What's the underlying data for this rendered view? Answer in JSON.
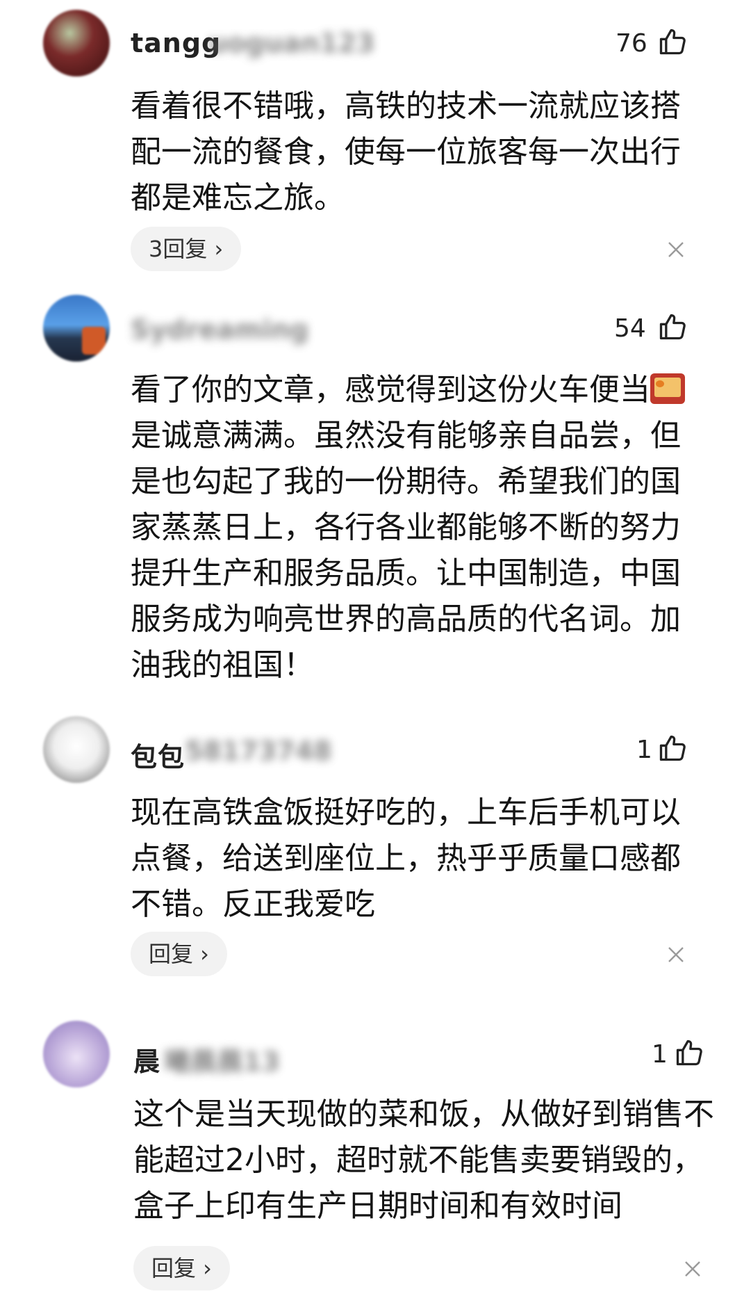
{
  "comments": [
    {
      "username_visible": "tangg",
      "username_blurred": "uoguan123",
      "likes": "76",
      "text": "看着很不错哦，高铁的技术一流就应该搭配一流的餐食，使每一位旅客每一次出行都是难忘之旅。",
      "reply_label": "3回复 ›"
    },
    {
      "username_visible": "",
      "username_blurred": "Sydreaming",
      "likes": "54",
      "text_before_emoji": "看了你的文章，感觉得到这份火车便当",
      "emoji": "bento-box",
      "text_after_emoji": "是诚意满满。虽然没有能够亲自品尝，但是也勾起了我的一份期待。希望我们的国家蒸蒸日上，各行各业都能够不断的努力提升生产和服务品质。让中国制造，中国服务成为响亮世界的高品质的代名词。加油我的祖国！"
    },
    {
      "username_visible": "包包",
      "username_blurred": "58173748",
      "likes": "1",
      "text": "现在高铁盒饭挺好吃的，上车后手机可以点餐，给送到座位上，热乎乎质量口感都不错。反正我爱吃",
      "reply_label": "回复 ›"
    },
    {
      "username_visible": "晨",
      "username_blurred": "曦晨晨13",
      "likes": "1",
      "text": "这个是当天现做的菜和饭，从做好到销售不能超过2小时，超时就不能售卖要销毁的，盒子上印有生产日期时间和有效时间",
      "reply_label": "回复 ›"
    }
  ],
  "icons": {
    "like": "thumbs-up-icon",
    "dismiss": "close-icon"
  }
}
